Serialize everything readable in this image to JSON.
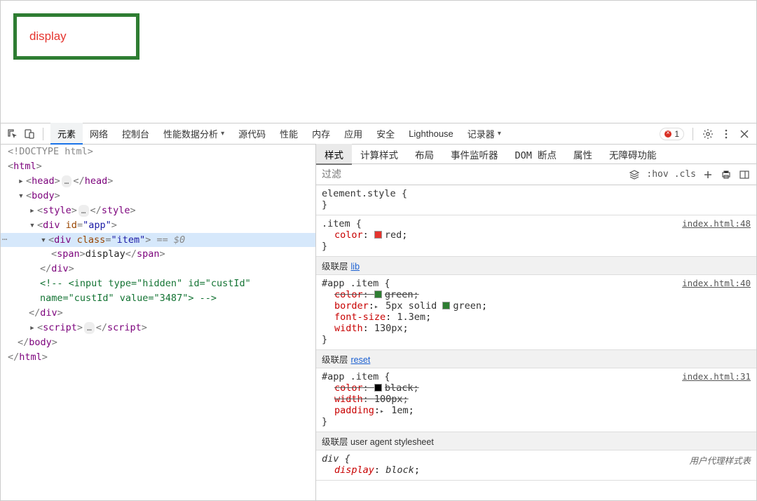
{
  "page": {
    "demo_text": "display"
  },
  "toolbar": {
    "tabs": {
      "elements": "元素",
      "network": "网络",
      "console": "控制台",
      "perf_insights": "性能数据分析",
      "sources": "源代码",
      "performance": "性能",
      "memory": "内存",
      "application": "应用",
      "security": "安全",
      "lighthouse": "Lighthouse",
      "recorder": "记录器"
    },
    "errors_count": "1"
  },
  "elements_tree": {
    "doctype": "<!DOCTYPE html>",
    "html_open": "html",
    "head": {
      "tag": "head",
      "ellipsis": "…"
    },
    "body": {
      "tag": "body"
    },
    "style": {
      "tag": "style",
      "ellipsis": "…"
    },
    "app_div": {
      "tag": "div",
      "attr_id": "id",
      "attr_id_val": "\"app\""
    },
    "item_div": {
      "tag": "div",
      "attr_class": "class",
      "attr_class_val": "\"item\"",
      "eq0": "== $0"
    },
    "span": {
      "tag": "span",
      "text": "display"
    },
    "comment": "<!-- <input type=\"hidden\" id=\"custId\"",
    "comment2": "name=\"custId\" value=\"3487\"> -->",
    "script": {
      "tag": "script",
      "ellipsis": "…"
    }
  },
  "styles_panel": {
    "tabs": {
      "styles": "样式",
      "computed": "计算样式",
      "layout": "布局",
      "listeners": "事件监听器",
      "dom_bp": "DOM 断点",
      "props": "属性",
      "a11y": "无障碍功能"
    },
    "filter_placeholder": "过滤",
    "tool_hov": ":hov",
    "tool_cls": ".cls",
    "element_style": {
      "selector": "element.style",
      "open": "{",
      "close": "}"
    },
    "rule_item": {
      "selector": ".item",
      "open": "{",
      "close": "}",
      "source": "index.html:48",
      "decl1_prop": "color",
      "decl1_val": "red",
      "decl1_color": "#e5342e"
    },
    "cascade_lib": {
      "label": "级联层",
      "link": "lib"
    },
    "rule_lib": {
      "selector": "#app .item",
      "open": "{",
      "close": "}",
      "source": "index.html:40",
      "d1_prop": "color",
      "d1_val": "green",
      "d1_color": "#2e7d32",
      "d2_prop": "border",
      "d2_val": "5px solid",
      "d2_val2": "green",
      "d2_color": "#2e7d32",
      "d3_prop": "font-size",
      "d3_val": "1.3em",
      "d4_prop": "width",
      "d4_val": "130px"
    },
    "cascade_reset": {
      "label": "级联层",
      "link": "reset"
    },
    "rule_reset": {
      "selector": "#app .item",
      "open": "{",
      "close": "}",
      "source": "index.html:31",
      "d1_prop": "color",
      "d1_val": "black",
      "d1_color": "#000000",
      "d2_prop": "width",
      "d2_val": "100px",
      "d3_prop": "padding",
      "d3_val": "1em"
    },
    "cascade_ua": {
      "label": "级联层 user agent stylesheet"
    },
    "rule_ua": {
      "selector": "div",
      "open": "{",
      "ua_note": "用户代理样式表",
      "d1_prop": "display",
      "d1_val": "block"
    }
  }
}
